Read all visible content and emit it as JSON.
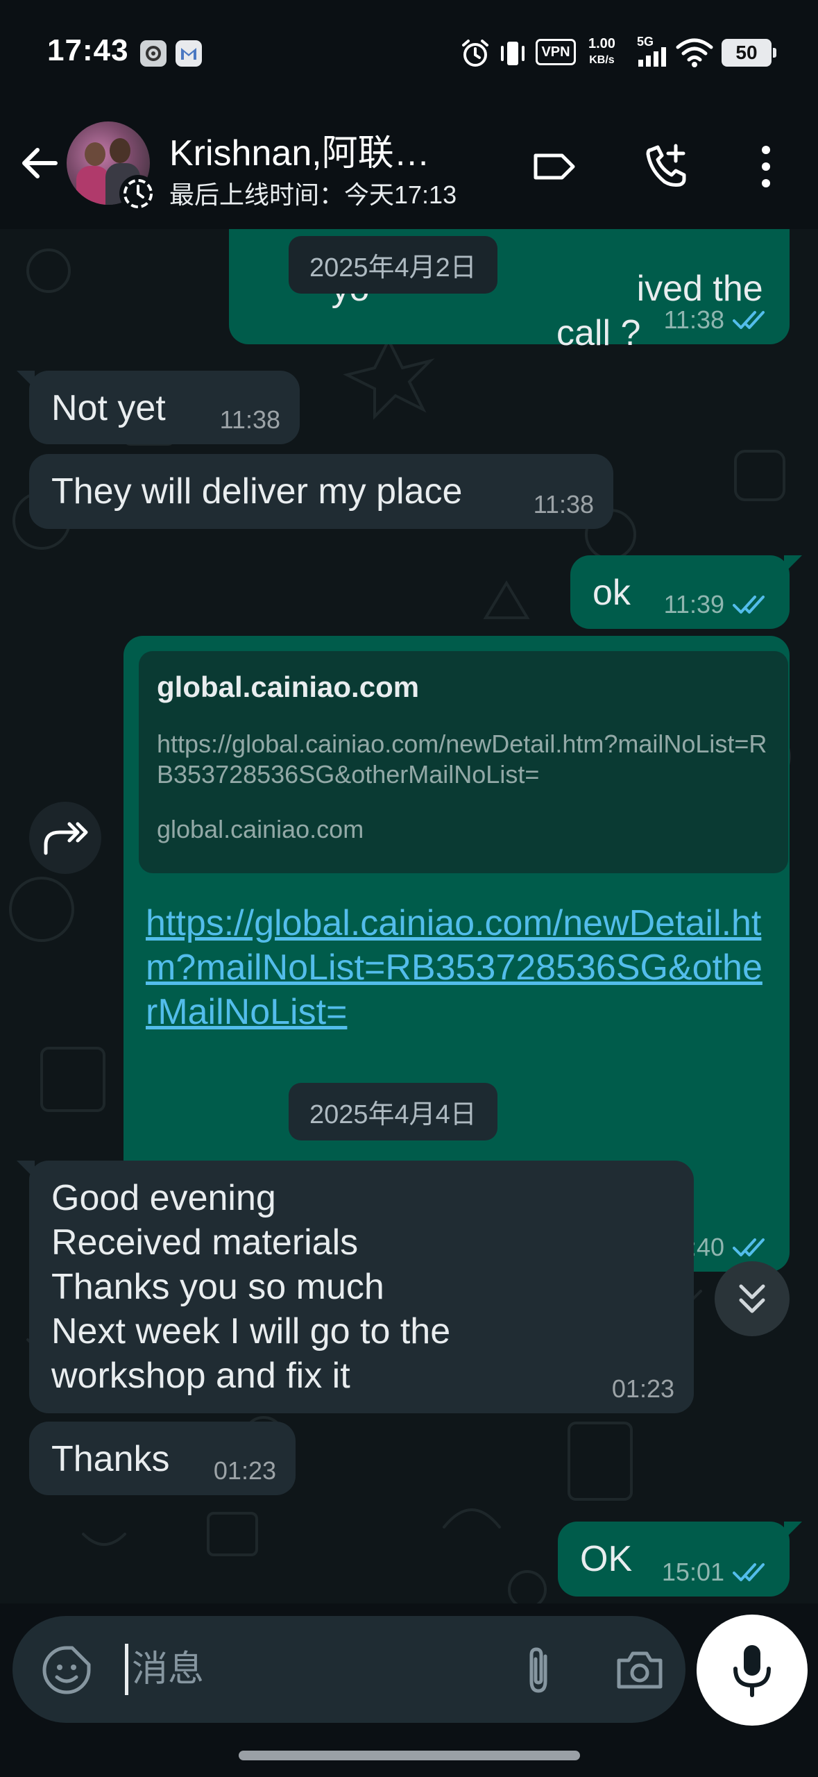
{
  "status_bar": {
    "time": "17:43",
    "vpn": "VPN",
    "speed_value": "1.00",
    "speed_unit": "KB/s",
    "network": "5G",
    "battery": "50"
  },
  "header": {
    "contact_name": "Krishnan,阿联…",
    "last_seen": "最后上线时间：今天17:13",
    "icons": [
      "back-arrow-icon",
      "label-icon",
      "add-call-icon",
      "more-vert-icon"
    ]
  },
  "chat": {
    "colors": {
      "incoming": "#202c33",
      "outgoing": "#005c4b",
      "link": "#53bdeb",
      "read_ticks": "#53bdeb"
    },
    "messages": [
      {
        "id": "m1",
        "direction": "out",
        "text": "you received the call ?",
        "visible_left": "yo",
        "visible_right": "ived the call ?",
        "time": "11:38",
        "status": "read"
      },
      {
        "id": "m2",
        "direction": "in",
        "text": "Not yet",
        "time": "11:38"
      },
      {
        "id": "m3",
        "direction": "in",
        "text": "They will deliver my place",
        "time": "11:38"
      },
      {
        "id": "m4",
        "direction": "out",
        "text": "ok",
        "time": "11:39",
        "status": "read"
      },
      {
        "id": "m5",
        "direction": "out",
        "type": "link",
        "preview": {
          "title": "global.cainiao.com",
          "description": "https://global.cainiao.com/newDetail.htm?mailNoList=RB353728536SG&otherMailNoList=",
          "domain": "global.cainiao.com"
        },
        "text": "https://global.cainiao.com/newDetail.htm?mailNoList=RB353728536SG&otherMailNoList=",
        "time": "11:40",
        "status": "read"
      },
      {
        "id": "m6",
        "direction": "in",
        "text": "Good evening\nReceived materials\nThanks you so much\nNext week I will go to the workshop and fix it",
        "time": "01:23"
      },
      {
        "id": "m7",
        "direction": "in",
        "text": "Thanks",
        "time": "01:23"
      },
      {
        "id": "m8",
        "direction": "out",
        "text": "OK",
        "time": "15:01",
        "status": "read"
      }
    ],
    "date_chips": [
      "2025年4月2日",
      "2025年4月4日"
    ]
  },
  "input": {
    "placeholder": "消息",
    "icons": [
      "sticker-icon",
      "attach-icon",
      "camera-icon",
      "mic-icon"
    ]
  }
}
